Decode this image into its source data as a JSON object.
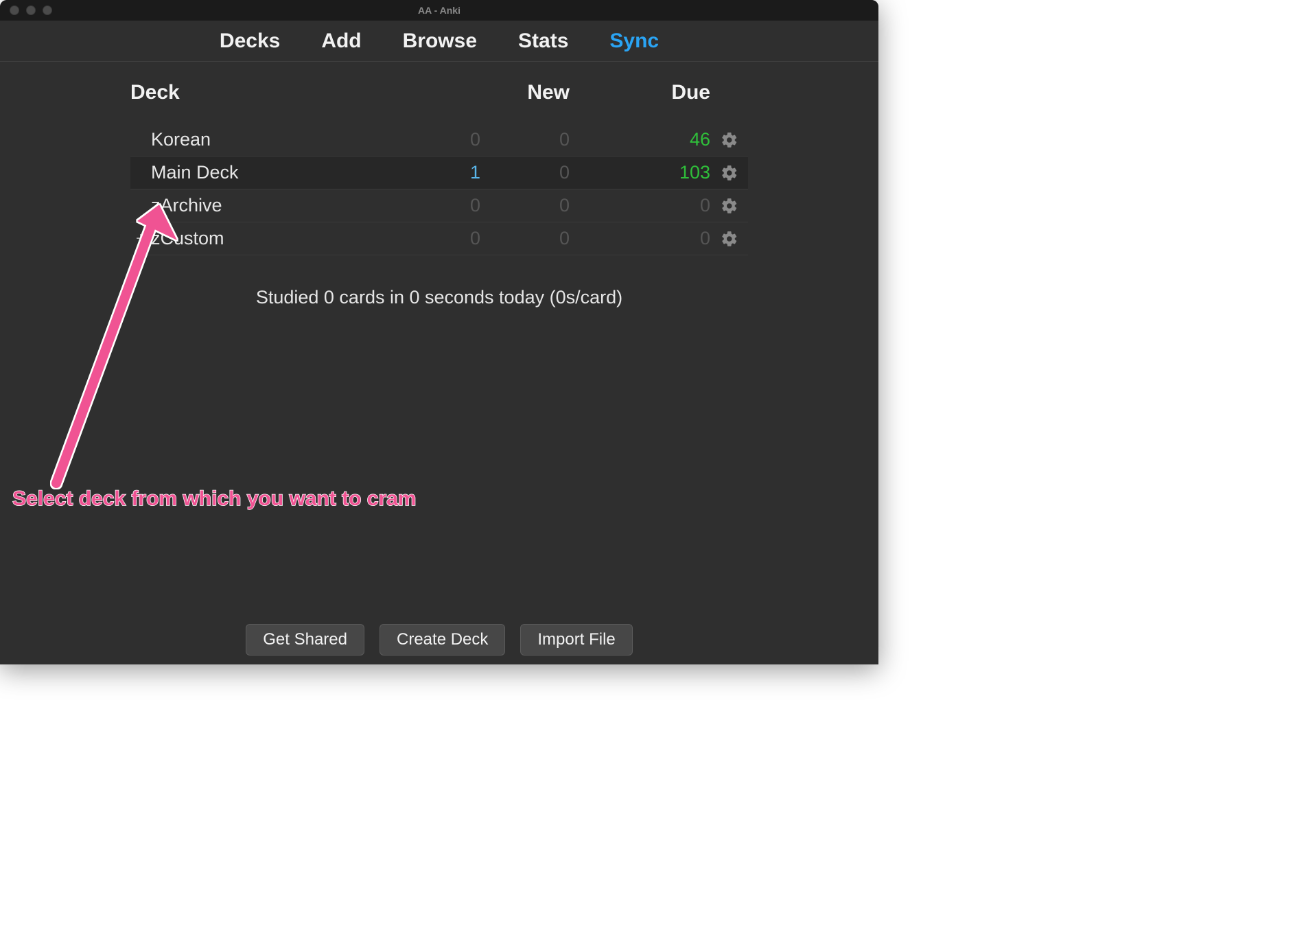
{
  "window": {
    "title": "AA - Anki"
  },
  "nav": {
    "decks": "Decks",
    "add": "Add",
    "browse": "Browse",
    "stats": "Stats",
    "sync": "Sync"
  },
  "headers": {
    "deck": "Deck",
    "new": "New",
    "due": "Due"
  },
  "decks": [
    {
      "name": "Korean",
      "expand": "",
      "new": "0",
      "learn": "0",
      "due": "46",
      "selected": false,
      "new_blue": false,
      "due_green": true
    },
    {
      "name": "Main Deck",
      "expand": "",
      "new": "1",
      "learn": "0",
      "due": "103",
      "selected": true,
      "new_blue": true,
      "due_green": true
    },
    {
      "name": "zArchive",
      "expand": "",
      "new": "0",
      "learn": "0",
      "due": "0",
      "selected": false,
      "new_blue": false,
      "due_green": false
    },
    {
      "name": "zCustom",
      "expand": "+",
      "new": "0",
      "learn": "0",
      "due": "0",
      "selected": false,
      "new_blue": false,
      "due_green": false
    }
  ],
  "studied": "Studied 0 cards in 0 seconds today (0s/card)",
  "bottom": {
    "get_shared": "Get Shared",
    "create_deck": "Create Deck",
    "import_file": "Import File"
  },
  "annotation": {
    "text": "Select deck from which you want to cram",
    "color": "#f05393"
  }
}
